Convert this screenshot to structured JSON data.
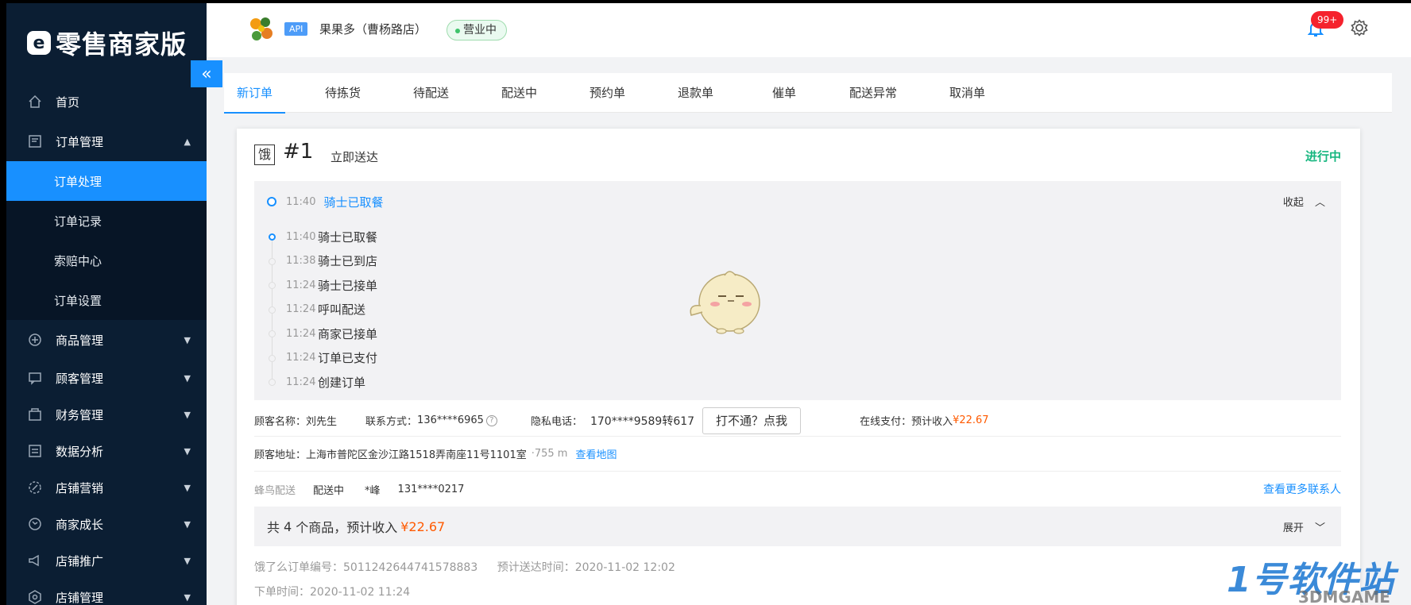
{
  "app": {
    "brand": "零售商家版",
    "brand_icon": "e-logo-icon"
  },
  "sidebar": {
    "items": [
      {
        "label": "首页",
        "icon": "home-icon"
      },
      {
        "label": "订单管理",
        "icon": "order-icon",
        "expanded": true
      },
      {
        "label": "订单处理",
        "active": true
      },
      {
        "label": "订单记录"
      },
      {
        "label": "索赔中心"
      },
      {
        "label": "订单设置"
      },
      {
        "label": "商品管理",
        "icon": "plus-circle-icon"
      },
      {
        "label": "顾客管理",
        "icon": "message-icon"
      },
      {
        "label": "财务管理",
        "icon": "wallet-icon"
      },
      {
        "label": "数据分析",
        "icon": "chart-icon"
      },
      {
        "label": "店铺营销",
        "icon": "coupon-icon"
      },
      {
        "label": "商家成长",
        "icon": "growth-icon"
      },
      {
        "label": "店铺推广",
        "icon": "megaphone-icon"
      },
      {
        "label": "店铺管理",
        "icon": "settings-icon"
      }
    ]
  },
  "header": {
    "api_tag": "API",
    "shop_name": "果果多（曹杨路店）",
    "status": "营业中",
    "notif_count": "99+"
  },
  "tabs": [
    {
      "label": "新订单",
      "active": true
    },
    {
      "label": "待拣货"
    },
    {
      "label": "待配送"
    },
    {
      "label": "配送中"
    },
    {
      "label": "预约单"
    },
    {
      "label": "退款单"
    },
    {
      "label": "催单"
    },
    {
      "label": "配送异常"
    },
    {
      "label": "取消单"
    }
  ],
  "order": {
    "platform_mark": "饿",
    "number": "#1",
    "type": "立即送达",
    "status": "进行中",
    "track_head_time": "11:40",
    "track_head_status": "骑士已取餐",
    "collapse_label": "收起",
    "timeline": [
      {
        "time": "11:40",
        "status": "骑士已取餐"
      },
      {
        "time": "11:38",
        "status": "骑士已到店"
      },
      {
        "time": "11:24",
        "status": "骑士已接单"
      },
      {
        "time": "11:24",
        "status": "呼叫配送"
      },
      {
        "time": "11:24",
        "status": "商家已接单"
      },
      {
        "time": "11:24",
        "status": "订单已支付"
      },
      {
        "time": "11:24",
        "status": "创建订单"
      }
    ],
    "customer_label": "顾客名称：",
    "customer_name": "刘先生",
    "contact_label": "联系方式：",
    "contact": "136****6965",
    "private_label": "隐私电话：",
    "private_phone": "170****9589转617",
    "call_button": "打不通？点我",
    "payment_label": "在线支付：预计收入",
    "payment_amount": "¥22.67",
    "address_label": "顾客地址：",
    "address": "上海市普陀区金沙江路1518弄南座11号1101室",
    "distance": "·755 m",
    "map_link": "查看地图",
    "delivery_provider": "蜂鸟配送",
    "delivery_status": "配送中",
    "rider_name": "*峰",
    "rider_phone": "131****0217",
    "more_contacts": "查看更多联系人",
    "summary_prefix": "共",
    "summary_count": "4",
    "summary_suffix": "个商品，预计收入",
    "summary_amount": "¥22.67",
    "expand_label": "展开",
    "order_id_label": "饿了么订单编号：",
    "order_id": "5011242644741578883",
    "eta_label": "预计送达时间：",
    "eta": "2020-11-02 12:02",
    "placed_label": "下单时间：",
    "placed_time": "2020-11-02 11:24"
  },
  "watermark": {
    "main": "1号软件站",
    "sub": "3DMGAME"
  }
}
